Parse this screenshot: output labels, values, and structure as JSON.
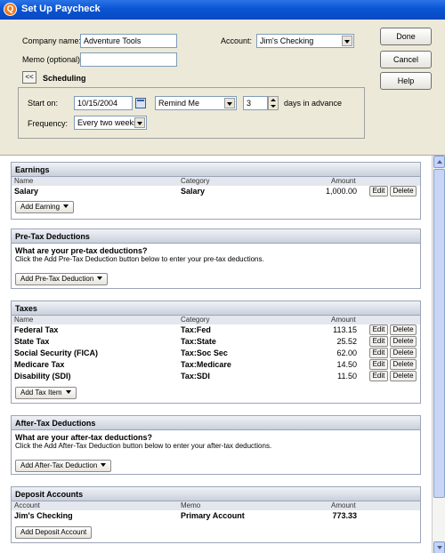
{
  "window": {
    "title": "Set Up Paycheck",
    "icon": "quicken-icon"
  },
  "form": {
    "company_label": "Company name:",
    "company_value": "Adventure Tools",
    "memo_label": "Memo (optional):",
    "memo_value": "",
    "account_label": "Account:",
    "account_value": "Jim's Checking",
    "collapse_label": "<<",
    "scheduling_label": "Scheduling",
    "start_label": "Start on:",
    "start_value": "10/15/2004",
    "remind_value": "Remind Me",
    "days_value": "3",
    "days_label": "days in advance",
    "frequency_label": "Frequency:",
    "frequency_value": "Every two weeks"
  },
  "buttons": {
    "done": "Done",
    "cancel": "Cancel",
    "help": "Help"
  },
  "columns": {
    "name": "Name",
    "category": "Category",
    "amount": "Amount",
    "account": "Account",
    "memo": "Memo"
  },
  "earnings": {
    "title": "Earnings",
    "rows": [
      {
        "name": "Salary",
        "category": "Salary",
        "amount": "1,000.00"
      }
    ],
    "add_label": "Add Earning"
  },
  "pretax": {
    "title": "Pre-Tax Deductions",
    "prompt": "What are your pre-tax deductions?",
    "help": "Click the Add Pre-Tax Deduction button below to enter your pre-tax deductions.",
    "add_label": "Add Pre-Tax Deduction"
  },
  "taxes": {
    "title": "Taxes",
    "rows": [
      {
        "name": "Federal Tax",
        "category": "Tax:Fed",
        "amount": "113.15"
      },
      {
        "name": "State Tax",
        "category": "Tax:State",
        "amount": "25.52"
      },
      {
        "name": "Social Security (FICA)",
        "category": "Tax:Soc Sec",
        "amount": "62.00"
      },
      {
        "name": "Medicare Tax",
        "category": "Tax:Medicare",
        "amount": "14.50"
      },
      {
        "name": "Disability (SDI)",
        "category": "Tax:SDI",
        "amount": "11.50"
      }
    ],
    "add_label": "Add Tax Item"
  },
  "aftertax": {
    "title": "After-Tax Deductions",
    "prompt": "What are your after-tax deductions?",
    "help": "Click the Add After-Tax Deduction button below to enter your after-tax deductions.",
    "add_label": "Add After-Tax Deduction"
  },
  "deposit": {
    "title": "Deposit Accounts",
    "rows": [
      {
        "account": "Jim's Checking",
        "memo": "Primary Account",
        "amount": "773.33"
      }
    ],
    "add_label": "Add Deposit Account"
  },
  "row_actions": {
    "edit": "Edit",
    "delete": "Delete"
  }
}
